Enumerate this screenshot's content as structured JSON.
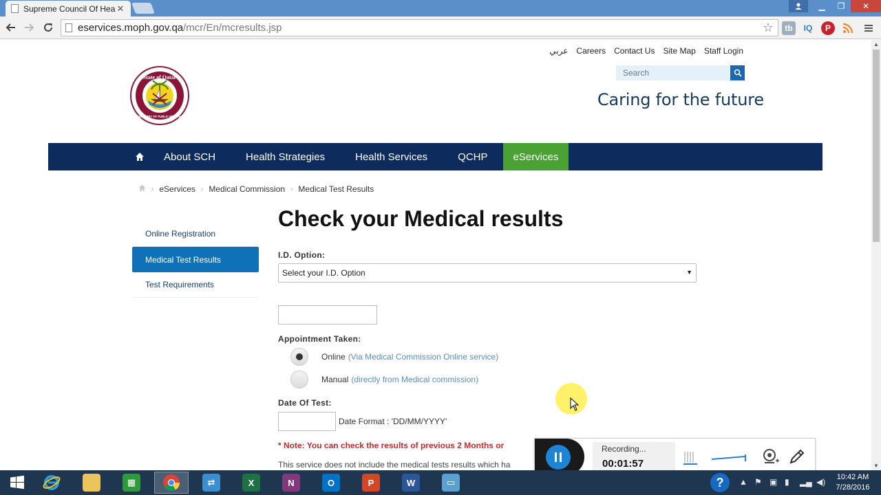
{
  "browser": {
    "tab_title": "Supreme Council Of Heal",
    "url_host": "eservices.moph.gov.qa",
    "url_path": "/mcr/En/mcresults.jsp",
    "extensions": [
      "tb",
      "IQ",
      "P",
      "rss"
    ]
  },
  "header": {
    "top_links": [
      "عربي",
      "Careers",
      "Contact Us",
      "Site Map",
      "Staff Login"
    ],
    "search_placeholder": "Search",
    "tagline": "Caring for the future",
    "logo_top_text": "State of Qatar",
    "logo_bottom_text": "MINISTRY OF PUBLIC HEALTH"
  },
  "nav": {
    "items": [
      "About SCH",
      "Health Strategies",
      "Health Services",
      "QCHP",
      "eServices"
    ],
    "active": "eServices",
    "active_color": "#4aa235",
    "bar_color": "#0d2b5c"
  },
  "breadcrumb": [
    "eServices",
    "Medical Commission",
    "Medical Test Results"
  ],
  "sidebar": {
    "items": [
      "Online Registration",
      "Medical Test Results",
      "Test Requirements"
    ],
    "active": "Medical Test Results"
  },
  "main": {
    "title": "Check your Medical results",
    "id_label": "I.D. Option:",
    "id_select_value": "Select your I.D. Option",
    "id_number_value": "",
    "appointment_label": "Appointment Taken:",
    "options": [
      {
        "label": "Online",
        "note": "(Via Medical Commission Online service)",
        "checked": true
      },
      {
        "label": "Manual",
        "note": "(directly from Medical commission)",
        "checked": false
      }
    ],
    "date_label": "Date Of Test:",
    "date_value": "",
    "date_format": "Date Format : 'DD/MM/YYYY'",
    "note": "* Note: You can check the results of previous 2 Months or",
    "info": "This service does not include the medical tests results which ha"
  },
  "recorder": {
    "status": "Recording...",
    "elapsed": "00:01:57"
  },
  "taskbar": {
    "apps": [
      "start",
      "ie",
      "explorer",
      "store",
      "chrome",
      "remote",
      "excel",
      "onenote",
      "outlook",
      "powerpoint",
      "word",
      "photos"
    ],
    "active": "chrome",
    "time": "10:42 AM",
    "date": "7/28/2016"
  }
}
